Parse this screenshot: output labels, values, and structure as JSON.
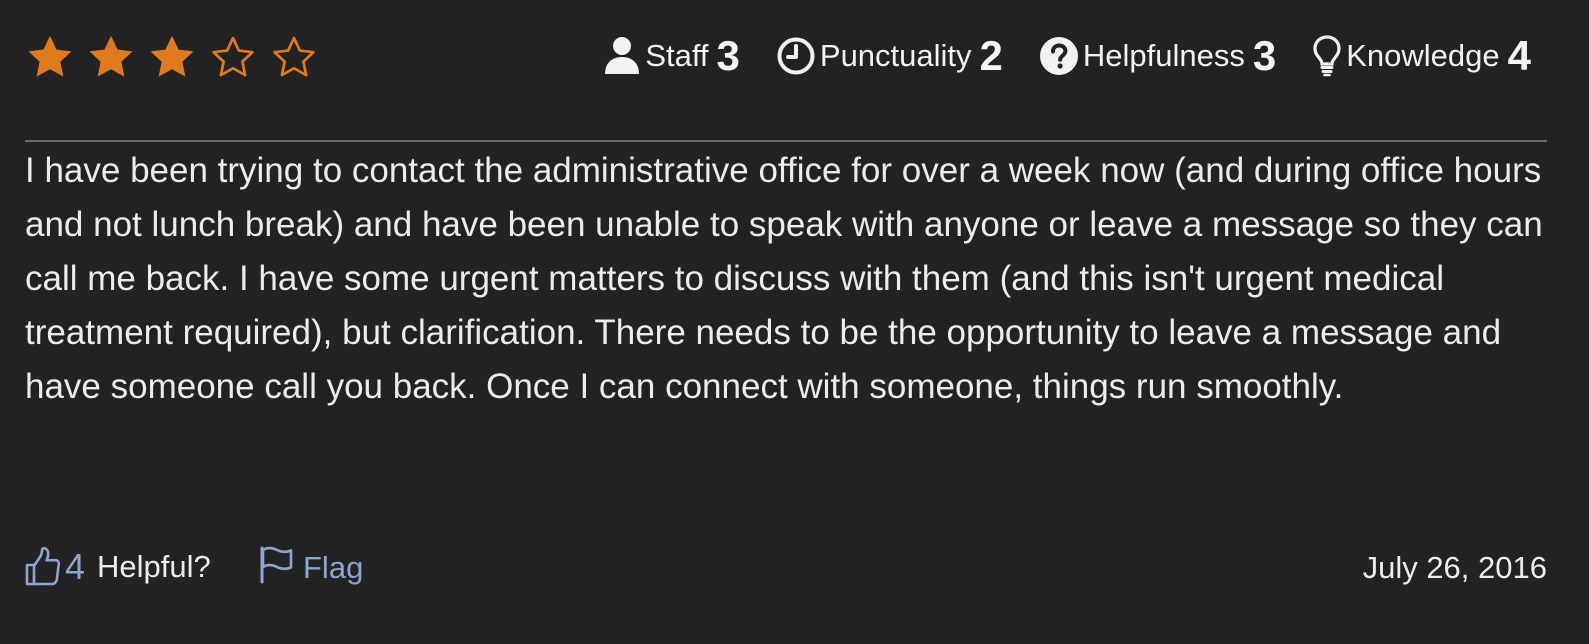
{
  "rating": {
    "overall": 3,
    "max": 5,
    "star_color": "#e07a1f"
  },
  "scores": [
    {
      "icon": "user-icon",
      "label": "Staff",
      "value": "3"
    },
    {
      "icon": "clock-icon",
      "label": "Punctuality",
      "value": "2"
    },
    {
      "icon": "question-circle-icon",
      "label": "Helpfulness",
      "value": "3"
    },
    {
      "icon": "lightbulb-icon",
      "label": "Knowledge",
      "value": "4"
    }
  ],
  "review": {
    "text": "I have been trying to contact the administrative office for over a week now (and during office hours and not lunch break) and have been unable to speak with anyone or leave a message so they can call me back. I have some urgent matters to discuss with them (and this isn't urgent medical treatment required), but clarification. There needs to be the opportunity to leave a message and have someone call you back. Once I can connect with someone, things run smoothly."
  },
  "footer": {
    "helpful_count": "4",
    "helpful_label": "Helpful?",
    "flag_label": "Flag",
    "date": "July 26, 2016",
    "link_color": "#8ea4d2"
  }
}
